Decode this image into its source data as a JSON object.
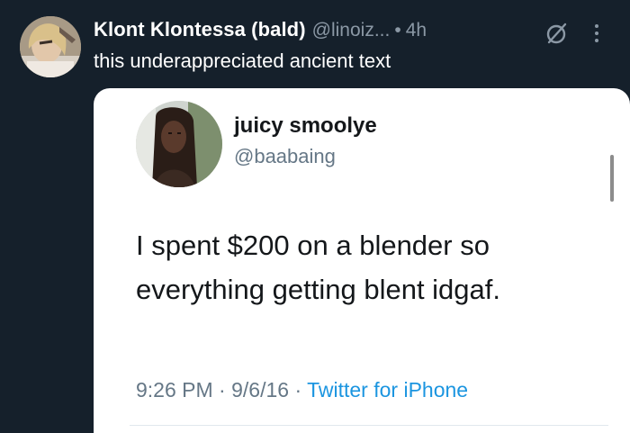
{
  "post": {
    "display_name": "Klont Klontessa (bald)",
    "handle": "@linoiz...",
    "separator": "•",
    "time": "4h",
    "text": "this underappreciated ancient text",
    "icons": {
      "grok": "grok-icon",
      "more": "more-vertical-icon"
    }
  },
  "embedded_tweet": {
    "name": "juicy smoolye",
    "handle": "@baabaing",
    "body_lines": [
      "I spent $200 on a blender so",
      "everything getting blent idgaf."
    ],
    "time": "9:26 PM",
    "date": "9/6/16",
    "sep": "·",
    "source": "Twitter for iPhone"
  },
  "colors": {
    "background": "#15202b",
    "primary_text": "#ffffff",
    "secondary_text": "#8b98a5",
    "link_blue": "#1b95e0"
  }
}
